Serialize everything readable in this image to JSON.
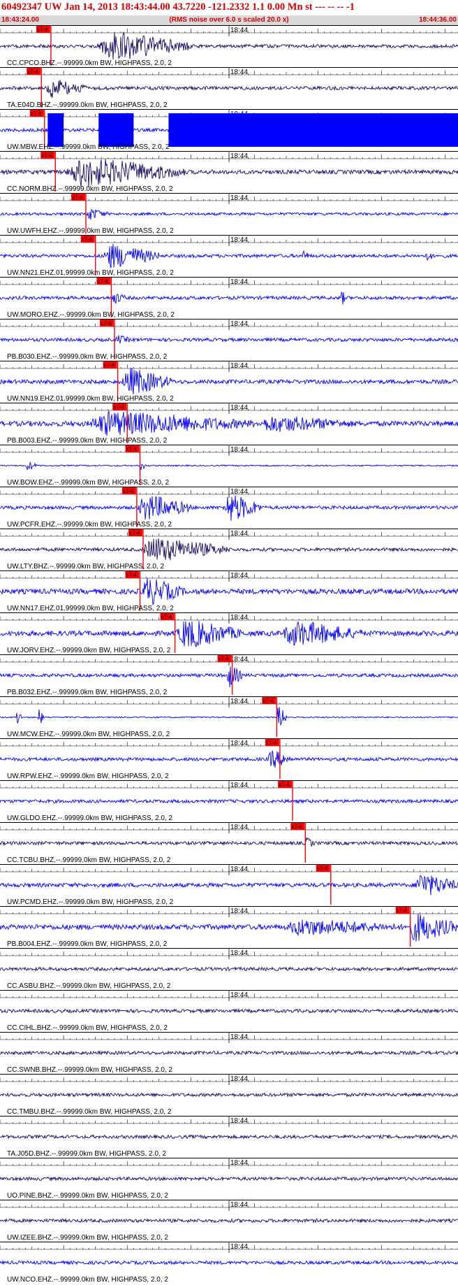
{
  "header": {
    "title": "60492347 UW Jan 14, 2013 18:43:44.00   43.7220 -121.2332  1.1 0.00 Mn st --- -- --  -1",
    "start_time": "18:43:24.00",
    "noise_note": "(RMS noise over 6.0 s scaled 20.0 x)",
    "end_time": "18:44:36.00"
  },
  "colors": {
    "title": "#d40000",
    "trace_blue": "#0000ff",
    "trace_dark": "#1a0b66",
    "pick": "#ff0000",
    "subbar": "#d9d9d9"
  },
  "chart_data": {
    "type": "line",
    "x_range_seconds": [
      0,
      72
    ],
    "minute_label": "18:44",
    "minute_mark_seconds": 36,
    "pick_label": "xT-4",
    "traces": [
      {
        "label": "CC.CPCO.BHZ.--.99999.0km BW, HIGHPASS, 2.0, 2",
        "color": "dark",
        "pick_s": 8.0,
        "events": [
          [
            15,
            30,
            0.95
          ]
        ],
        "saturated": [],
        "base": 0.1
      },
      {
        "label": "TA.E04D.BHZ.--.99999.0km BW, HIGHPASS, 2.0, 2",
        "color": "dark",
        "pick_s": 6.5,
        "events": [
          [
            7,
            14,
            0.6
          ]
        ],
        "saturated": [],
        "base": 0.1
      },
      {
        "label": "UW.MBW.EHZ.--.99999.0km BW, HIGHPASS, 2.0, 2",
        "color": "blue",
        "pick_s": 7.0,
        "events": [],
        "saturated": [
          [
            7.5,
            10.0
          ],
          [
            15.5,
            21.0
          ],
          [
            26.5,
            72.0
          ]
        ],
        "base": 0.1
      },
      {
        "label": "CC.NORM.BHZ.--.99999.0km BW, HIGHPASS, 2.0, 2",
        "color": "dark",
        "pick_s": 8.7,
        "events": [
          [
            10,
            29,
            0.95
          ]
        ],
        "saturated": [],
        "base": 0.12
      },
      {
        "label": "UW.UWFH.EHZ.--.99999.0km BW, HIGHPASS, 2.0, 2",
        "color": "blue",
        "pick_s": 13.5,
        "events": [
          [
            13.5,
            17,
            0.4
          ]
        ],
        "saturated": [],
        "base": 0.08
      },
      {
        "label": "UW.NN21.EHZ.01.99999.0km BW, HIGHPASS, 2.0, 2",
        "color": "blue",
        "pick_s": 15.0,
        "events": [
          [
            16,
            25,
            0.8
          ],
          [
            47.5,
            48.5,
            0.5
          ],
          [
            67,
            68,
            0.5
          ]
        ],
        "saturated": [],
        "base": 0.1
      },
      {
        "label": "UW.MORO.EHZ.--.99999.0km BW, HIGHPASS, 2.0, 2",
        "color": "blue",
        "pick_s": 17.5,
        "events": [
          [
            17.5,
            20,
            0.4
          ],
          [
            53.5,
            54.5,
            0.5
          ]
        ],
        "saturated": [],
        "base": 0.1
      },
      {
        "label": "PB.B030.EHZ.--.99999.0km BW, HIGHPASS, 2.0, 2",
        "color": "blue",
        "pick_s": 18.0,
        "events": [
          [
            18,
            21,
            0.3
          ]
        ],
        "saturated": [],
        "base": 0.1
      },
      {
        "label": "UW.NN19.EHZ.01.99999.0km BW, HIGHPASS, 2.0, 2",
        "color": "blue",
        "pick_s": 18.5,
        "events": [
          [
            19,
            27,
            0.9
          ]
        ],
        "saturated": [],
        "base": 0.12
      },
      {
        "label": "PB.B003.EHZ.--.99999.0km BW, HIGHPASS, 2.0, 2",
        "color": "blue",
        "pick_s": 20.0,
        "events": [
          [
            13,
            40,
            0.8
          ],
          [
            40,
            57,
            0.55
          ]
        ],
        "saturated": [],
        "base": 0.15
      },
      {
        "label": "UW.BOW.EHZ.--.99999.0km BW, HIGHPASS, 2.0, 2",
        "color": "blue",
        "pick_s": 22.0,
        "events": [
          [
            4,
            6,
            0.3
          ],
          [
            22,
            23,
            0.3
          ]
        ],
        "saturated": [],
        "base": 0.04
      },
      {
        "label": "UW.PCFR.EHZ.--.99999.0km BW, HIGHPASS, 2.0, 2",
        "color": "blue",
        "pick_s": 21.5,
        "events": [
          [
            21.5,
            30,
            0.85
          ],
          [
            35,
            41,
            0.95
          ]
        ],
        "saturated": [],
        "base": 0.1
      },
      {
        "label": "UW.LTY.BHZ.--.99999.0km BW, HIGHPASS, 2.0, 2",
        "color": "dark",
        "pick_s": 22.5,
        "events": [
          [
            22,
            36,
            0.8
          ]
        ],
        "saturated": [],
        "base": 0.1
      },
      {
        "label": "UW.NN17.EHZ.01.99999.0km BW, HIGHPASS, 2.0, 2",
        "color": "blue",
        "pick_s": 22.0,
        "events": [
          [
            22,
            29,
            0.9
          ]
        ],
        "saturated": [],
        "base": 0.15
      },
      {
        "label": "UW.JORV.EHZ.--.99999.0km BW, HIGHPASS, 2.0, 2",
        "color": "blue",
        "pick_s": 27.5,
        "events": [
          [
            27.5,
            38,
            0.95
          ],
          [
            44,
            57,
            0.85
          ]
        ],
        "saturated": [],
        "base": 0.15
      },
      {
        "label": "PB.B032.EHZ.--.99999.0km BW, HIGHPASS, 2.0, 2",
        "color": "blue",
        "pick_s": 36.5,
        "events": [
          [
            35.5,
            38,
            0.8
          ]
        ],
        "saturated": [],
        "base": 0.1
      },
      {
        "label": "UW.MCW.EHZ.--.99999.0km BW, HIGHPASS, 2.0, 2",
        "color": "blue",
        "pick_s": 43.5,
        "events": [
          [
            2.5,
            3.5,
            0.5
          ],
          [
            6,
            7,
            0.5
          ],
          [
            43.5,
            45,
            0.8
          ]
        ],
        "saturated": [],
        "base": 0.04
      },
      {
        "label": "UW.RPW.EHZ.--.99999.0km BW, HIGHPASS, 2.0, 2",
        "color": "blue",
        "pick_s": 44.0,
        "events": [
          [
            42,
            46,
            0.6
          ]
        ],
        "saturated": [],
        "base": 0.1
      },
      {
        "label": "UW.GLDO.EHZ.--.99999.0km BW, HIGHPASS, 2.0, 2",
        "color": "blue",
        "pick_s": 46.0,
        "events": [],
        "saturated": [],
        "base": 0.1
      },
      {
        "label": "CC.TCBU.BHZ.--.99999.0km BW, HIGHPASS, 2.0, 2",
        "color": "dark",
        "pick_s": 48.0,
        "events": [
          [
            48,
            49.5,
            0.4
          ]
        ],
        "saturated": [],
        "base": 0.1
      },
      {
        "label": "UW.PCMD.EHZ.--.99999.0km BW, HIGHPASS, 2.0, 2",
        "color": "blue",
        "pick_s": 52.0,
        "events": [
          [
            65,
            72,
            0.8
          ]
        ],
        "saturated": [],
        "base": 0.12
      },
      {
        "label": "PB.B004.EHZ.--.99999.0km BW, HIGHPASS, 2.0, 2",
        "color": "blue",
        "pick_s": 64.5,
        "events": [
          [
            44,
            64,
            0.55
          ],
          [
            64,
            72,
            0.95
          ]
        ],
        "saturated": [],
        "base": 0.15
      },
      {
        "label": "CC.ASBU.BHZ.--.99999.0km BW, HIGHPASS, 2.0, 2",
        "color": "dark",
        "pick_s": null,
        "events": [],
        "saturated": [],
        "base": 0.1
      },
      {
        "label": "CC.CIHL.BHZ.--.99999.0km BW, HIGHPASS, 2.0, 2",
        "color": "dark",
        "pick_s": null,
        "events": [],
        "saturated": [],
        "base": 0.1
      },
      {
        "label": "CC.SWNB.BHZ.--.99999.0km BW, HIGHPASS, 2.0, 2",
        "color": "dark",
        "pick_s": null,
        "events": [],
        "saturated": [],
        "base": 0.1
      },
      {
        "label": "CC.TMBU.BHZ.--.99999.0km BW, HIGHPASS, 2.0, 2",
        "color": "dark",
        "pick_s": null,
        "events": [],
        "saturated": [],
        "base": 0.1
      },
      {
        "label": "TA.J05D.BHZ.--.99999.0km BW, HIGHPASS, 2.0, 2",
        "color": "dark",
        "pick_s": null,
        "events": [],
        "saturated": [],
        "base": 0.1
      },
      {
        "label": "UO.PINE.BHZ.--.99999.0km BW, HIGHPASS, 2.0, 2",
        "color": "dark",
        "pick_s": null,
        "events": [],
        "saturated": [],
        "base": 0.1
      },
      {
        "label": "UW.IZEE.BHZ.--.99999.0km BW, HIGHPASS, 2.0, 2",
        "color": "dark",
        "pick_s": null,
        "events": [],
        "saturated": [],
        "base": 0.1
      },
      {
        "label": "UW.NCO.EHZ.--.99999.0km BW, HIGHPASS, 2.0, 2",
        "color": "blue",
        "pick_s": null,
        "events": [],
        "saturated": [],
        "base": 0.1
      }
    ]
  }
}
